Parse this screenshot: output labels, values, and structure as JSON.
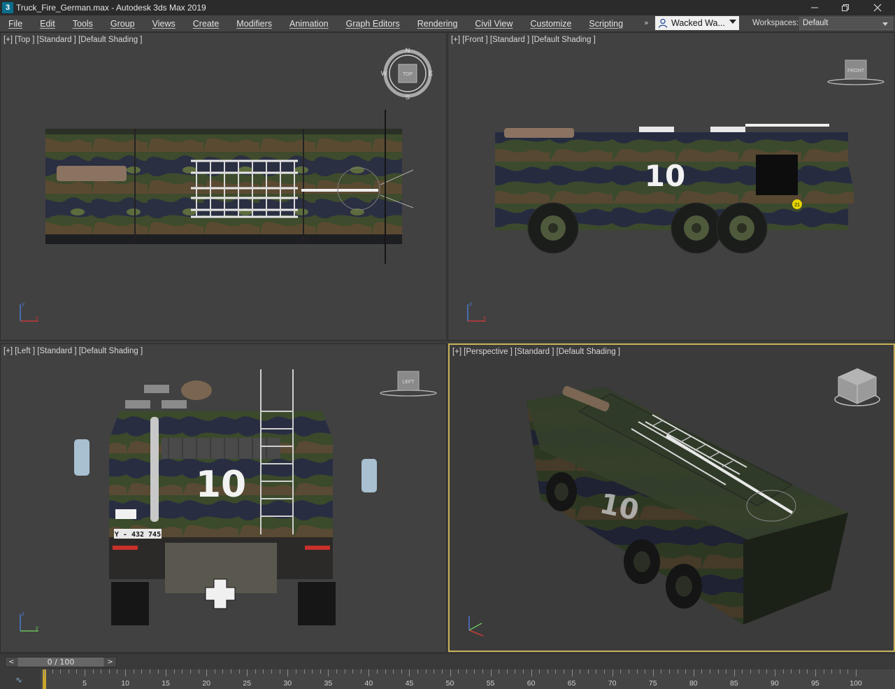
{
  "window": {
    "app_icon_glyph": "3",
    "title": "Truck_Fire_German.max - Autodesk 3ds Max 2019",
    "minimize_icon": "minimize-icon",
    "restore_icon": "restore-icon",
    "close_icon": "close-icon"
  },
  "menubar": {
    "items": [
      "File",
      "Edit",
      "Tools",
      "Group",
      "Views",
      "Create",
      "Modifiers",
      "Animation",
      "Graph Editors",
      "Rendering",
      "Civil View",
      "Customize",
      "Scripting"
    ],
    "overflow": "»",
    "user_label": "Wacked Wa...",
    "workspaces_label": "Workspaces:",
    "workspace_value": "Default"
  },
  "viewports": {
    "top": {
      "label": "[+] [Top ] [Standard ] [Default Shading ]"
    },
    "front": {
      "label": "[+] [Front ] [Standard ] [Default Shading ]",
      "cube_label": "FRONT",
      "truck_number": "10",
      "badge": "21"
    },
    "left": {
      "label": "[+] [Left ] [Standard ] [Default Shading ]",
      "cube_label": "LEFT",
      "truck_number": "10",
      "plate": "Y - 432 745"
    },
    "persp": {
      "label": "[+] [Perspective ] [Standard ] [Default Shading ]",
      "truck_number": "10"
    },
    "compass": {
      "n": "N",
      "s": "S",
      "e": "E",
      "w": "W",
      "center": "TOP"
    }
  },
  "timeline": {
    "frame_readout": "0 / 100",
    "prev_arrow": "<",
    "next_arrow": ">",
    "current_frame": 0,
    "ticks": [
      "5",
      "10",
      "15",
      "20",
      "25",
      "30",
      "35",
      "40",
      "45",
      "50",
      "55",
      "60",
      "65",
      "70",
      "75",
      "80",
      "85",
      "90",
      "95",
      "100"
    ]
  },
  "colors": {
    "accent_active_viewport": "#c8b25a",
    "camo_dark": "#2c3a26",
    "camo_green": "#4a5a34",
    "camo_brown": "#5a4a32",
    "camo_navy": "#2a2f44"
  }
}
